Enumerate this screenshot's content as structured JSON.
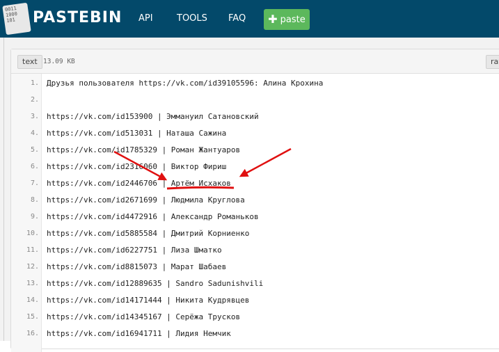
{
  "header": {
    "logo_lines": [
      "0011",
      "1000",
      "101"
    ],
    "brand": "PASTEBIN",
    "nav": [
      "API",
      "TOOLS",
      "FAQ"
    ],
    "paste_button": "paste"
  },
  "paste": {
    "format_tag": "text",
    "size": "13.09 KB",
    "raw_button": "raw",
    "lines": [
      {
        "n": "1.",
        "text": "Друзья пользователя https://vk.com/id39105596: Алина Крохина"
      },
      {
        "n": "2.",
        "text": ""
      },
      {
        "n": "3.",
        "text": "https://vk.com/id153900 | Эммануил Сатановский"
      },
      {
        "n": "4.",
        "text": "https://vk.com/id513031 | Наташа Сажина"
      },
      {
        "n": "5.",
        "text": "https://vk.com/id1785329 | Роман Жантуаров"
      },
      {
        "n": "6.",
        "text": "https://vk.com/id2316060 | Виктор Фириш"
      },
      {
        "n": "7.",
        "text": "https://vk.com/id2446706 | Артём Исхаков"
      },
      {
        "n": "8.",
        "text": "https://vk.com/id2671699 | Людмила Круглова"
      },
      {
        "n": "9.",
        "text": "https://vk.com/id4472916 | Александр Романьков"
      },
      {
        "n": "10.",
        "text": "https://vk.com/id5885584 | Дмитрий Корниенко"
      },
      {
        "n": "11.",
        "text": "https://vk.com/id6227751 | Лиза Шматко"
      },
      {
        "n": "12.",
        "text": "https://vk.com/id8815073 | Марат Шабаев"
      },
      {
        "n": "13.",
        "text": "https://vk.com/id12889635 | Sandro Sadunishvili"
      },
      {
        "n": "14.",
        "text": "https://vk.com/id14171444 | Никита Кудрявцев"
      },
      {
        "n": "15.",
        "text": "https://vk.com/id14345167 | Серёжа Трусков"
      },
      {
        "n": "16.",
        "text": "https://vk.com/id16941711 | Лидия Немчик"
      }
    ]
  },
  "colors": {
    "navbar": "#03496a",
    "paste_button": "#5cb85c",
    "annotation": "#e01010"
  }
}
